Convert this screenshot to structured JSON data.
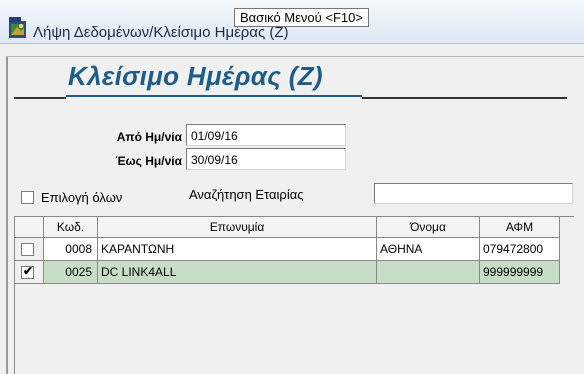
{
  "window": {
    "title": "Λήψη Δεδομένων/Κλείσιμο Ημέρας (Ζ)",
    "tooltip": "Βασικό Μενού <F10>"
  },
  "page": {
    "title": "Κλείσιμο Ημέρας (Ζ)"
  },
  "filters": {
    "from_label": "Από Ημ/νία",
    "from_value": "01/09/16",
    "to_label": "Έως Ημ/νία",
    "to_value": "30/09/16",
    "select_all_label": "Επιλογή όλων",
    "select_all_checked": false,
    "search_label": "Αναζήτηση Εταιρίας",
    "search_value": ""
  },
  "table": {
    "columns": [
      "Κωδ.",
      "Επωνυμία",
      "Όνομα",
      "ΑΦΜ"
    ],
    "rows": [
      {
        "checked": false,
        "code": "0008",
        "name": "ΚΑΡΑΝΤΩΝΗ",
        "onoma": "ΑΘΗΝΑ",
        "afm": "079472800",
        "selected": false
      },
      {
        "checked": true,
        "code": "0025",
        "name": "DC LINK4ALL",
        "onoma": "",
        "afm": "999999999",
        "selected": true
      }
    ]
  },
  "colors": {
    "title_blue": "#1e5d87",
    "selected_row": "#c5dec5"
  }
}
